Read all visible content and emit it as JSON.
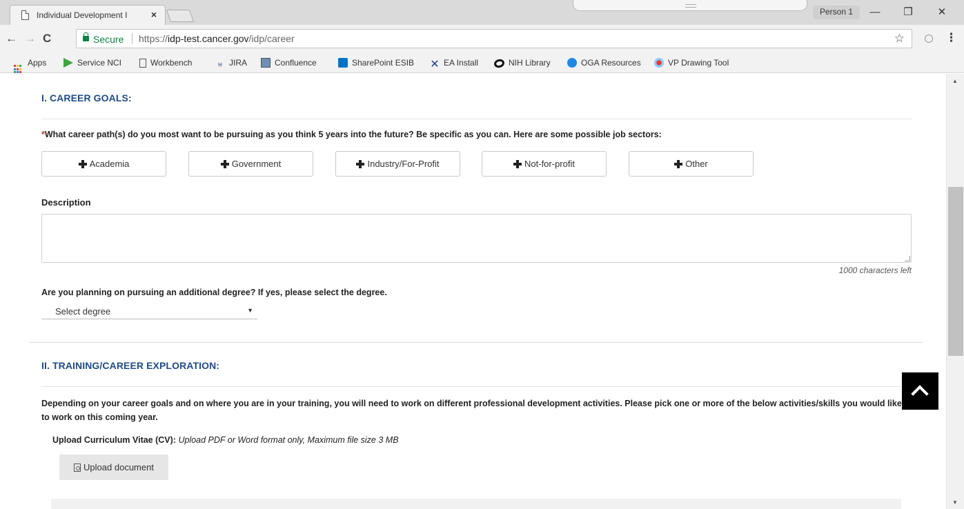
{
  "browser": {
    "tab_title": "Individual Development I",
    "tab_close": "×",
    "profile": "Person 1",
    "window_controls": {
      "minimize": "—",
      "restore": "❐",
      "close": "✕"
    },
    "nav": {
      "back": "←",
      "forward": "→",
      "reload": "C"
    },
    "secure_label": "Secure",
    "url_scheme": "https://",
    "url_host": "idp-test.cancer.gov",
    "url_path": "/idp/career",
    "star": "☆",
    "menu": "⋮"
  },
  "bookmarks": [
    {
      "label": "Apps",
      "icon": "apps-grid-icon"
    },
    {
      "label": "Service NCI",
      "icon": "service-nci-icon",
      "color": "#3fa33f"
    },
    {
      "label": "Workbench",
      "icon": "page-icon"
    },
    {
      "label": "JIRA",
      "icon": "jira-icon"
    },
    {
      "label": "Confluence",
      "icon": "confluence-icon"
    },
    {
      "label": "SharePoint ESIB",
      "icon": "sharepoint-icon",
      "color": "#0072c6"
    },
    {
      "label": "EA Install",
      "icon": "ea-install-icon",
      "color": "#1e3f8a"
    },
    {
      "label": "NIH Library",
      "icon": "nih-library-icon"
    },
    {
      "label": "OGA Resources",
      "icon": "oga-resources-icon"
    },
    {
      "label": "VP Drawing Tool",
      "icon": "vp-drawing-icon"
    }
  ],
  "career": {
    "section1_title": "I. CAREER GOALS:",
    "required_mark": "*",
    "question": "What career path(s) do you most want to be pursuing as you think 5 years into the future? Be specific as you can. Here are some possible job sectors:",
    "sectors": [
      "Academia",
      "Government",
      "Industry/For-Profit",
      "Not-for-profit",
      "Other"
    ],
    "description_label": "Description",
    "description_value": "",
    "chars_left": "1000 characters left",
    "degree_question": "Are you planning on pursuing an additional degree? If yes, please select the degree.",
    "degree_selected": "Select degree",
    "section2_title": "II. TRAINING/CAREER EXPLORATION:",
    "training_paragraph": "Depending on your career goals and on where you are in your training, you will need to work on different professional development activities. Please pick one or more of the below activities/skills you would like to work on this coming year.",
    "upload_label": "Upload Curriculum Vitae (CV):",
    "upload_hint": "Upload PDF or Word format only, Maximum file size 3 MB",
    "upload_button": "Upload document"
  },
  "colors": {
    "section_title": "#1e4b87",
    "required": "#c0392b",
    "secure": "#0b8043"
  }
}
